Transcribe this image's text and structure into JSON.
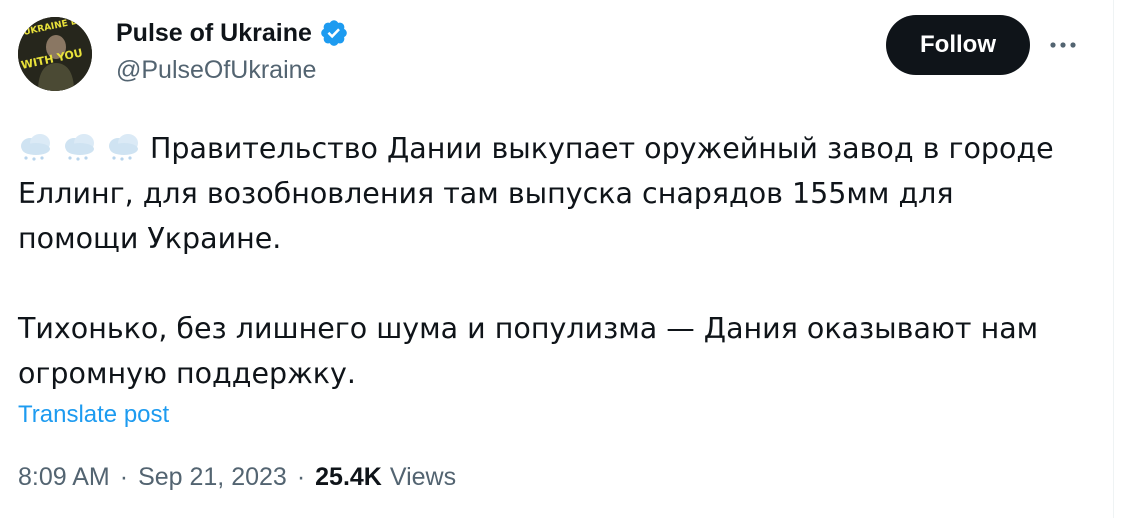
{
  "author": {
    "display_name": "Pulse of Ukraine",
    "handle": "@PulseOfUkraine",
    "verified_color": "#1d9bf0",
    "avatar_text_line1": "UKRAINE BEGINS",
    "avatar_text_line2": "WITH YOU"
  },
  "actions": {
    "follow_label": "Follow",
    "more_icon": "more-horizontal-icon"
  },
  "post": {
    "emoji": [
      "snow-cloud-icon",
      "snow-cloud-icon",
      "snow-cloud-icon"
    ],
    "paragraph1": "Правительство Дании выкупает оружейный завод в городе Еллинг, для возобновления там выпуска снарядов 155мм для помощи Украине.",
    "paragraph2": "Тихонько, без лишнего шума и популизма  — Дания оказывают нам огромную поддержку.",
    "translate_label": "Translate post"
  },
  "meta": {
    "time": "8:09 AM",
    "separator": "·",
    "date": "Sep 21, 2023",
    "views_count": "25.4K",
    "views_label": "Views"
  },
  "colors": {
    "text": "#0f1419",
    "secondary": "#536471",
    "accent": "#1d9bf0",
    "follow_bg": "#0f1419"
  }
}
